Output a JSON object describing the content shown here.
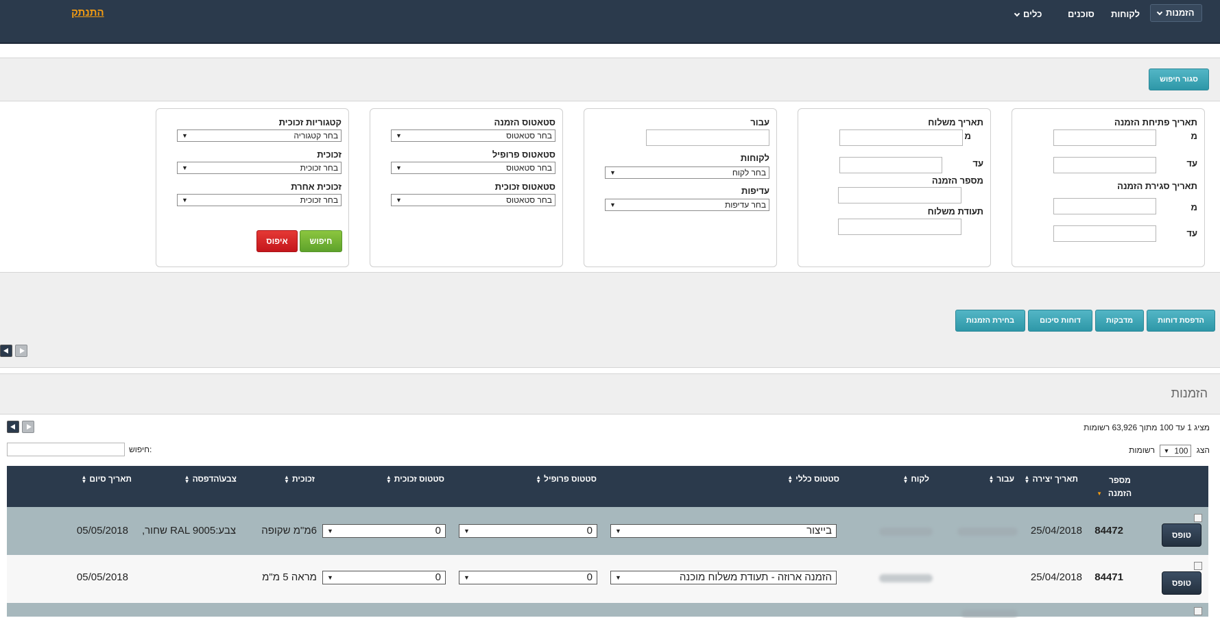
{
  "nav": {
    "logout": "התנתק",
    "items": [
      "הזמנות",
      "לקוחות",
      "סוכנים",
      "כלים"
    ]
  },
  "search_bar": {
    "close_search": "סגור חיפוש"
  },
  "filters": {
    "order_open_date": "תאריך פתיחת הזמנה",
    "from": "מ",
    "to": "עד",
    "order_close_date": "תאריך סגירת הזמנה",
    "ship_date": "תאריך משלוח",
    "order_number": "מספר הזמנה",
    "ship_doc": "תעודת משלוח",
    "for": "עבור",
    "customers": "לקוחות",
    "customer_select": "בחר לקוח",
    "priorities": "עדיפות",
    "priority_select": "בחר עדיפות",
    "order_status": "סטאטוס הזמנה",
    "profile_status": "סטאטוס פרופיל",
    "glass_status": "סטאטוס זכוכית",
    "status_select": "בחר סטאטוס",
    "glass_categories": "קטגוריות זכוכית",
    "category_select": "בחר קטגוריה",
    "glass": "זכוכית",
    "glass_select": "בחר זכוכית",
    "other_glass": "זכוכית אחרת",
    "search_btn": "חיפוש",
    "reset_btn": "איפוס"
  },
  "actions": {
    "print_reports": "הדפסת דוחות",
    "stickers": "מדבקות",
    "summary_reports": "דוחות סיכום",
    "select_orders": "בחירת הזמנות"
  },
  "orders": {
    "title": "הזמנות",
    "showing": "מציג 1 עד 100 מתוך 63,926 רשומות",
    "show": "הצג",
    "page_size": "100",
    "records": "רשומות",
    "search_label": "חיפוש:",
    "columns": {
      "order_number": "מספר הזמנה",
      "created": "תאריך יצירה",
      "for": "עבור",
      "customer": "לקוח",
      "general_status": "סטטוס כללי",
      "profile_status": "סטטוס פרופיל",
      "glass_status": "סטטוס זכוכית",
      "glass": "זכוכית",
      "color_print": "צבע\\הדפסה",
      "end_date": "תאריך סיום"
    },
    "rows": [
      {
        "form_btn": "טופס",
        "order_number": "84472",
        "created": "25/04/2018",
        "general_status": "בייצור",
        "profile_status": "0",
        "glass_status": "0",
        "glass": "6מ\"מ שקופה",
        "color_print": "צבע:RAL 9005 שחור,",
        "end_date": "05/05/2018"
      },
      {
        "form_btn": "טופס",
        "order_number": "84471",
        "created": "25/04/2018",
        "general_status": "הזמנה ארוזה - תעודת משלוח מוכנה",
        "profile_status": "0",
        "glass_status": "0",
        "glass": "מראה 5 מ\"מ",
        "color_print": "",
        "end_date": "05/05/2018"
      }
    ]
  },
  "colors": {
    "navy": "#2b3a4c",
    "teal": "#2e97a8",
    "accent": "#f39c12",
    "row_alt": "#a7b8bd"
  }
}
